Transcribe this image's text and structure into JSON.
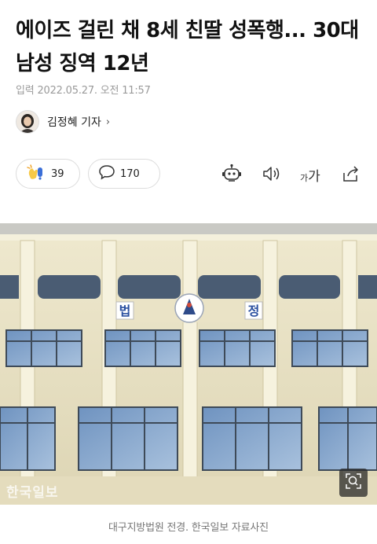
{
  "article": {
    "headline": "에이즈 걸린 채 8세 친딸 성폭행... 30대 남성 징역 12년",
    "published_label": "입력",
    "published_at": "2022.05.27. 오전 11:57",
    "reporter": {
      "name": "김정혜 기자"
    }
  },
  "actions": {
    "like_count": "39",
    "comment_count": "170",
    "font_size_label_small": "가",
    "font_size_label_large": "가"
  },
  "photo": {
    "sign_left": "법",
    "sign_right": "정",
    "watermark": "한국일보",
    "caption": "대구지방법원 전경. 한국일보 자료사진"
  },
  "icons": {
    "like": "clap-hands-icon",
    "comment": "speech-bubble-icon",
    "tts_robot": "robot-icon",
    "audio": "speaker-icon",
    "font_size": "font-size-icon",
    "share": "share-icon",
    "zoom": "zoom-icon"
  }
}
